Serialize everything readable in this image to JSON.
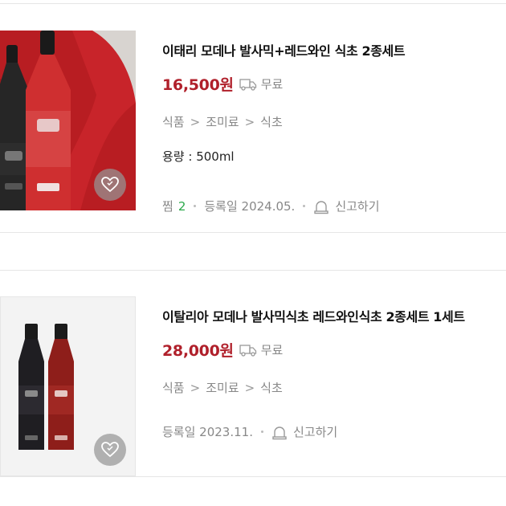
{
  "items": [
    {
      "title": "이태리 모데나 발사믹+레드와인 식초 2종세트",
      "price": "16,500원",
      "shipping": "무료",
      "category": [
        "식품",
        "조미료",
        "식초"
      ],
      "spec": "용량 : 500ml",
      "zzim_label": "찜",
      "zzim_count": "2",
      "registered": "등록일 2024.05.",
      "report": "신고하기"
    },
    {
      "title": "이탈리아 모데나 발사믹식초 레드와인식초 2종세트 1세트",
      "price": "28,000원",
      "shipping": "무료",
      "category": [
        "식품",
        "조미료",
        "식초"
      ],
      "registered": "등록일 2023.11.",
      "report": "신고하기"
    }
  ],
  "colors": {
    "price": "#b0202b",
    "zzim_count": "#2aa84a",
    "muted": "#888888"
  },
  "icons": [
    "truck-icon",
    "heart-icon",
    "siren-icon"
  ]
}
